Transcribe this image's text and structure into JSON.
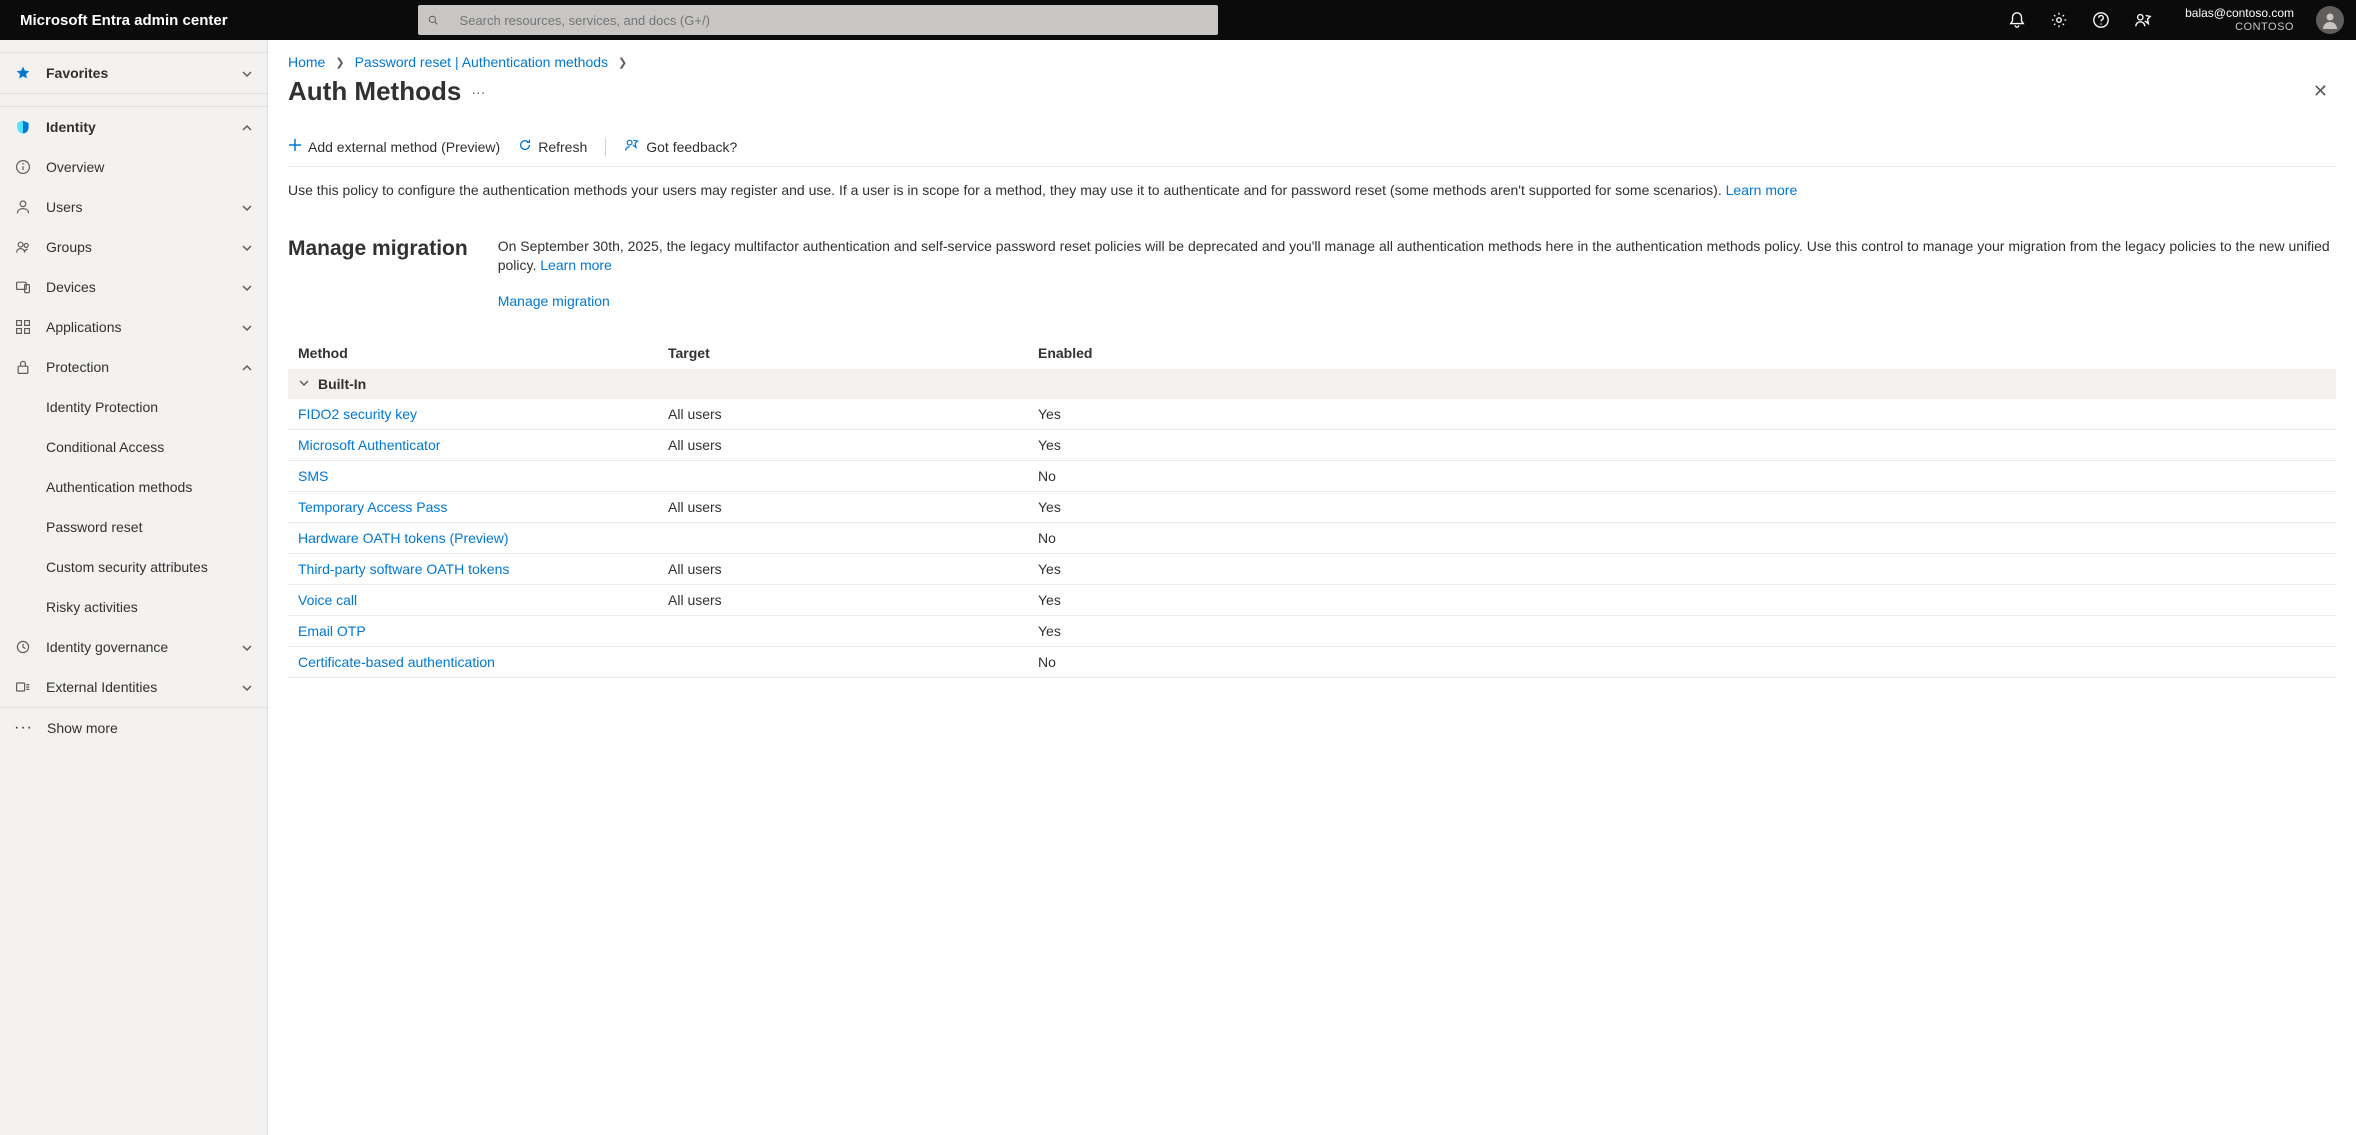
{
  "header": {
    "brand": "Microsoft Entra admin center",
    "search_placeholder": "Search resources, services, and docs (G+/)",
    "account_email": "balas@contoso.com",
    "account_org": "CONTOSO"
  },
  "sidebar": {
    "favorites_label": "Favorites",
    "identity_label": "Identity",
    "items": {
      "overview": "Overview",
      "users": "Users",
      "groups": "Groups",
      "devices": "Devices",
      "applications": "Applications",
      "protection": "Protection",
      "id_gov": "Identity governance",
      "ext_id": "External Identities"
    },
    "protection_sub": {
      "identity_protection": "Identity Protection",
      "conditional_access": "Conditional Access",
      "auth_methods": "Authentication methods",
      "password_reset": "Password reset",
      "custom_sec_attr": "Custom security attributes",
      "risky_activities": "Risky activities"
    },
    "show_more": "Show more"
  },
  "breadcrumb": {
    "home": "Home",
    "pr_auth": "Password reset | Authentication methods"
  },
  "page": {
    "title": "Auth Methods"
  },
  "toolbar": {
    "add_external": "Add external method (Preview)",
    "refresh": "Refresh",
    "feedback": "Got feedback?"
  },
  "policy": {
    "desc": "Use this policy to configure the authentication methods your users may register and use. If a user is in scope for a method, they may use it to authenticate and for password reset (some methods aren't supported for some scenarios).",
    "learn_more": "Learn more"
  },
  "migration": {
    "title": "Manage migration",
    "body": "On September 30th, 2025, the legacy multifactor authentication and self-service password reset policies will be deprecated and you'll manage all authentication methods here in the authentication methods policy. Use this control to manage your migration from the legacy policies to the new unified policy.",
    "learn_more": "Learn more",
    "link": "Manage migration"
  },
  "table": {
    "headers": {
      "method": "Method",
      "target": "Target",
      "enabled": "Enabled"
    },
    "group_label": "Built-In",
    "rows": [
      {
        "method": "FIDO2 security key",
        "target": "All users",
        "enabled": "Yes"
      },
      {
        "method": "Microsoft Authenticator",
        "target": "All users",
        "enabled": "Yes"
      },
      {
        "method": "SMS",
        "target": "",
        "enabled": "No"
      },
      {
        "method": "Temporary Access Pass",
        "target": "All users",
        "enabled": "Yes"
      },
      {
        "method": "Hardware OATH tokens (Preview)",
        "target": "",
        "enabled": "No"
      },
      {
        "method": "Third-party software OATH tokens",
        "target": "All users",
        "enabled": "Yes"
      },
      {
        "method": "Voice call",
        "target": "All users",
        "enabled": "Yes"
      },
      {
        "method": "Email OTP",
        "target": "",
        "enabled": "Yes"
      },
      {
        "method": "Certificate-based authentication",
        "target": "",
        "enabled": "No"
      }
    ]
  }
}
